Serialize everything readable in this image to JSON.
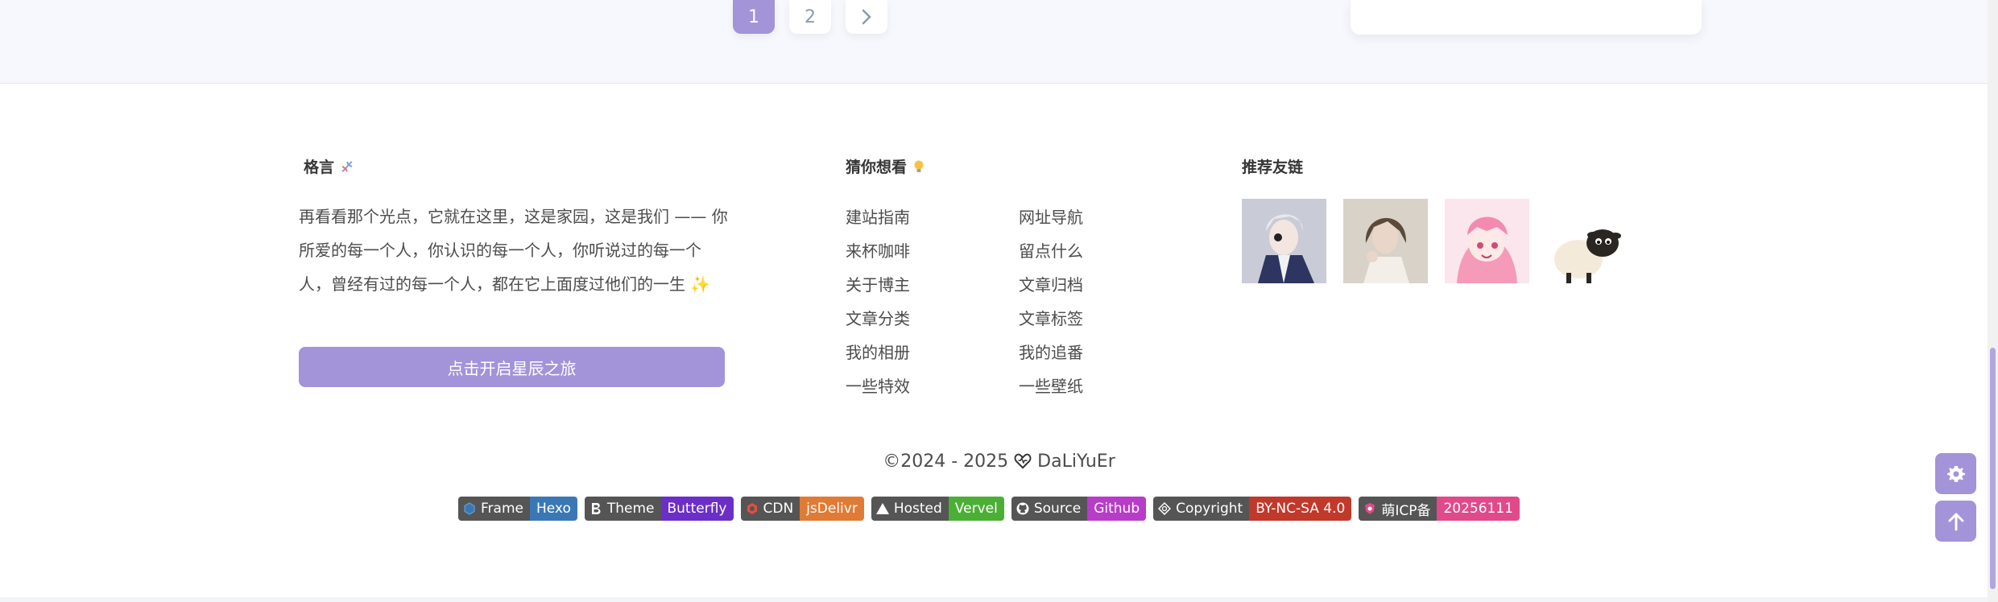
{
  "pagination": {
    "pages": [
      "1",
      "2"
    ],
    "next_icon": "chevron-right-icon"
  },
  "footer": {
    "motto": {
      "title": "格言",
      "icon": "dna-icon",
      "text": "再看看那个光点，它就在这里，这是家园，这是我们 —— 你所爱的每一个人，你认识的每一个人，你听说过的每一个人，曾经有过的每一个人，都在它上面度过他们的一生",
      "sparkle": "✨",
      "button_label": "点击开启星辰之旅"
    },
    "guess": {
      "title": "猜你想看",
      "icon": "bulb-icon",
      "col1": [
        "建站指南",
        "来杯咖啡",
        "关于博主",
        "文章分类",
        "我的相册",
        "一些特效"
      ],
      "col2": [
        "网址导航",
        "留点什么",
        "文章归档",
        "文章标签",
        "我的追番",
        "一些壁纸"
      ]
    },
    "friends": {
      "title": "推荐友链",
      "avatars": [
        "avatar-white-hair",
        "avatar-dark-hair",
        "avatar-pink-hair",
        "avatar-sheep"
      ]
    },
    "copyright": {
      "text_prefix": "©2024 - 2025",
      "heart_icon": "heart-icon",
      "author": "DaLiYuEr"
    },
    "badges": [
      {
        "left": "Frame",
        "right": "Hexo",
        "color": "#3a78b5"
      },
      {
        "left": "Theme",
        "right": "Butterfly",
        "color": "#6b2fc8"
      },
      {
        "left": "CDN",
        "right": "jsDelivr",
        "color": "#e07b35"
      },
      {
        "left": "Hosted",
        "right": "Vervel",
        "color": "#4caf35"
      },
      {
        "left": "Source",
        "right": "Github",
        "color": "#b73cc8"
      },
      {
        "left": "Copyright",
        "right": "BY-NC-SA 4.0",
        "color": "#c0392b"
      },
      {
        "left": "萌ICP备",
        "right": "20256111",
        "color": "#e04a8a"
      }
    ]
  },
  "floating": {
    "settings_icon": "gear-icon",
    "top_icon": "arrow-up-icon"
  }
}
